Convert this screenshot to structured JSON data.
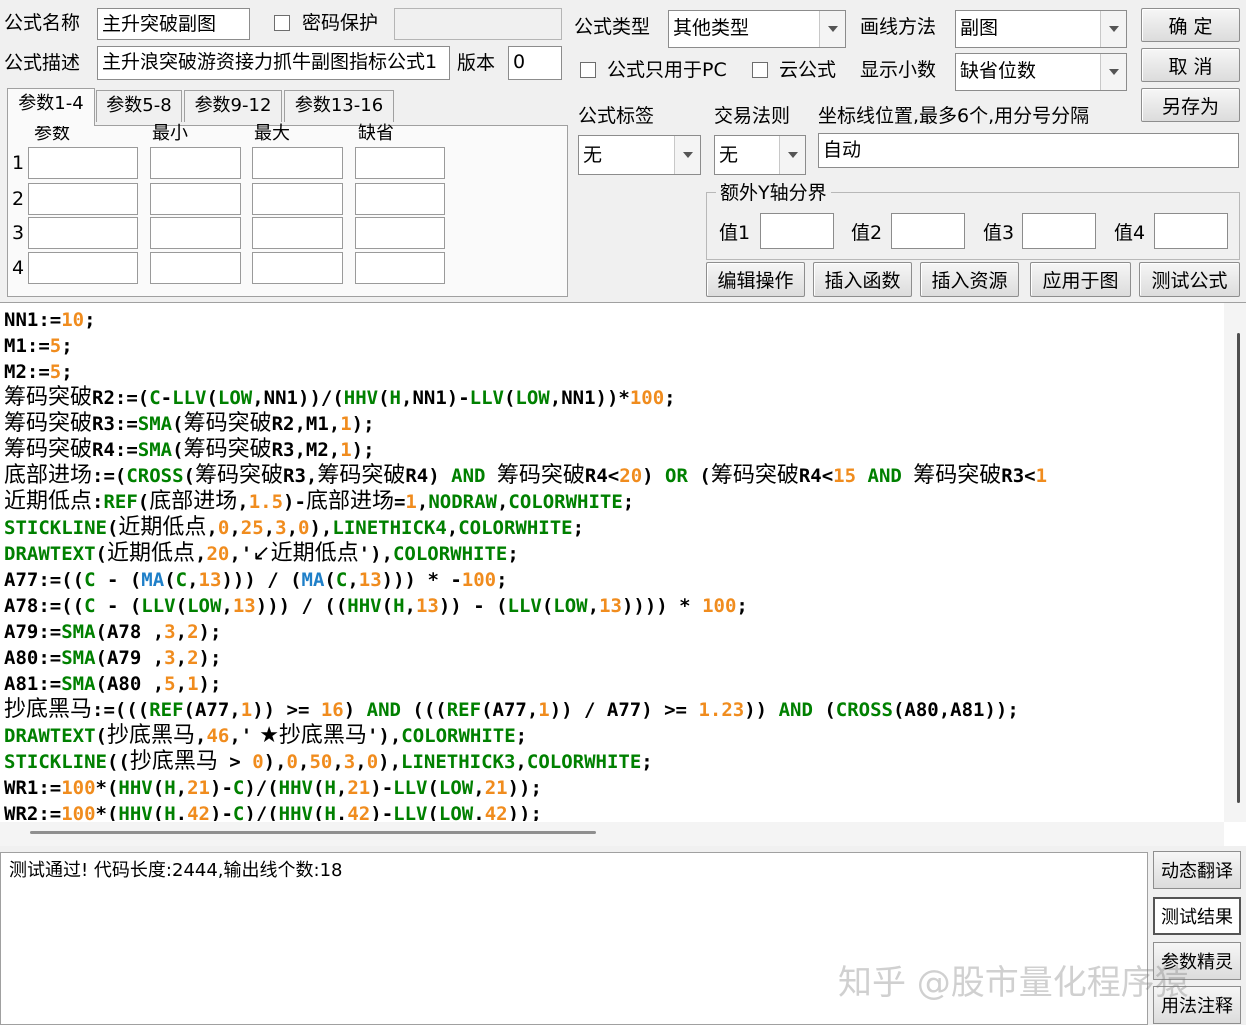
{
  "form": {
    "name_label": "公式名称",
    "name_value": "主升突破副图",
    "password_label": "密码保护",
    "desc_label": "公式描述",
    "desc_value": "主升浪突破游资接力抓牛副图指标公式1",
    "version_label": "版本",
    "version_value": "0",
    "type_label": "公式类型",
    "type_value": "其他类型",
    "draw_label": "画线方法",
    "draw_value": "副图",
    "pc_only_label": "公式只用于PC",
    "cloud_label": "云公式",
    "decimals_label": "显示小数",
    "decimals_value": "缺省位数",
    "tag_label": "公式标签",
    "tag_value": "无",
    "rule_label": "交易法则",
    "rule_value": "无",
    "axis_label": "坐标线位置,最多6个,用分号分隔",
    "axis_value": "自动",
    "extra_y_label": "额外Y轴分界",
    "extra_y": [
      "值1",
      "值2",
      "值3",
      "值4"
    ]
  },
  "buttons": {
    "ok": "确  定",
    "cancel": "取  消",
    "save_as": "另存为",
    "edit_ops": "编辑操作",
    "insert_func": "插入函数",
    "insert_res": "插入资源",
    "apply_chart": "应用于图",
    "test_formula": "测试公式"
  },
  "params": {
    "tabs": [
      "参数1-4",
      "参数5-8",
      "参数9-12",
      "参数13-16"
    ],
    "headers": [
      "参数",
      "最小",
      "最大",
      "缺省"
    ],
    "rows": [
      "1",
      "2",
      "3",
      "4"
    ]
  },
  "code_lines": [
    [
      [
        "t",
        "NN1:="
      ],
      [
        "n",
        "10"
      ],
      [
        "t",
        ";"
      ]
    ],
    [
      [
        "t",
        "M1:="
      ],
      [
        "n",
        "5"
      ],
      [
        "t",
        ";"
      ]
    ],
    [
      [
        "t",
        "M2:="
      ],
      [
        "n",
        "5"
      ],
      [
        "t",
        ";"
      ]
    ],
    [
      [
        "cj",
        "筹码突破"
      ],
      [
        "t",
        "R2:=("
      ],
      [
        "k",
        "C"
      ],
      [
        "t",
        "-"
      ],
      [
        "k",
        "LLV"
      ],
      [
        "t",
        "("
      ],
      [
        "k",
        "LOW"
      ],
      [
        "t",
        ",NN1)"
      ],
      [
        "t",
        ")/("
      ],
      [
        "k",
        "HHV"
      ],
      [
        "t",
        "("
      ],
      [
        "k",
        "H"
      ],
      [
        "t",
        ",NN1)-"
      ],
      [
        "k",
        "LLV"
      ],
      [
        "t",
        "("
      ],
      [
        "k",
        "LOW"
      ],
      [
        "t",
        ",NN1))*"
      ],
      [
        "n",
        "100"
      ],
      [
        "t",
        ";"
      ]
    ],
    [
      [
        "cj",
        "筹码突破"
      ],
      [
        "t",
        "R3:="
      ],
      [
        "k",
        "SMA"
      ],
      [
        "t",
        "("
      ],
      [
        "cj",
        "筹码突破"
      ],
      [
        "t",
        "R2,M1,"
      ],
      [
        "n",
        "1"
      ],
      [
        "t",
        ");"
      ]
    ],
    [
      [
        "cj",
        "筹码突破"
      ],
      [
        "t",
        "R4:="
      ],
      [
        "k",
        "SMA"
      ],
      [
        "t",
        "("
      ],
      [
        "cj",
        "筹码突破"
      ],
      [
        "t",
        "R3,M2,"
      ],
      [
        "n",
        "1"
      ],
      [
        "t",
        ");"
      ]
    ],
    [
      [
        "cj",
        "底部进场"
      ],
      [
        "t",
        ":=("
      ],
      [
        "k",
        "CROSS"
      ],
      [
        "t",
        "("
      ],
      [
        "cj",
        "筹码突破"
      ],
      [
        "t",
        "R3,"
      ],
      [
        "cj",
        "筹码突破"
      ],
      [
        "t",
        "R4) "
      ],
      [
        "k",
        "AND"
      ],
      [
        "t",
        " "
      ],
      [
        "cj",
        "筹码突破"
      ],
      [
        "t",
        "R4<"
      ],
      [
        "n",
        "20"
      ],
      [
        "t",
        ") "
      ],
      [
        "k",
        "OR"
      ],
      [
        "t",
        " ("
      ],
      [
        "cj",
        "筹码突破"
      ],
      [
        "t",
        "R4<"
      ],
      [
        "n",
        "15"
      ],
      [
        "t",
        " "
      ],
      [
        "k",
        "AND"
      ],
      [
        "t",
        " "
      ],
      [
        "cj",
        "筹码突破"
      ],
      [
        "t",
        "R3<"
      ],
      [
        "n",
        "1"
      ]
    ],
    [
      [
        "cj",
        "近期低点"
      ],
      [
        "t",
        ":"
      ],
      [
        "k",
        "REF"
      ],
      [
        "t",
        "("
      ],
      [
        "cj",
        "底部进场"
      ],
      [
        "t",
        ","
      ],
      [
        "n",
        "1.5"
      ],
      [
        "t",
        ")-"
      ],
      [
        "cj",
        "底部进场"
      ],
      [
        "t",
        "="
      ],
      [
        "n",
        "1"
      ],
      [
        "t",
        ","
      ],
      [
        "k",
        "NODRAW"
      ],
      [
        "t",
        ","
      ],
      [
        "k",
        "COLORWHITE"
      ],
      [
        "t",
        ";"
      ]
    ],
    [
      [
        "k",
        "STICKLINE"
      ],
      [
        "t",
        "("
      ],
      [
        "cj",
        "近期低点"
      ],
      [
        "t",
        ","
      ],
      [
        "n",
        "0"
      ],
      [
        "t",
        ","
      ],
      [
        "n",
        "25"
      ],
      [
        "t",
        ","
      ],
      [
        "n",
        "3"
      ],
      [
        "t",
        ","
      ],
      [
        "n",
        "0"
      ],
      [
        "t",
        "),"
      ],
      [
        "k",
        "LINETHICK4"
      ],
      [
        "t",
        ","
      ],
      [
        "k",
        "COLORWHITE"
      ],
      [
        "t",
        ";"
      ]
    ],
    [
      [
        "k",
        "DRAWTEXT"
      ],
      [
        "t",
        "("
      ],
      [
        "cj",
        "近期低点"
      ],
      [
        "t",
        ","
      ],
      [
        "n",
        "20"
      ],
      [
        "t",
        ",'"
      ],
      [
        "cj",
        "↙近期低点"
      ],
      [
        "t",
        "'),"
      ],
      [
        "k",
        "COLORWHITE"
      ],
      [
        "t",
        ";"
      ]
    ],
    [
      [
        "t",
        "A77:=(("
      ],
      [
        "k",
        "C"
      ],
      [
        "t",
        " - ("
      ],
      [
        "b",
        "MA"
      ],
      [
        "t",
        "("
      ],
      [
        "k",
        "C"
      ],
      [
        "t",
        ","
      ],
      [
        "n",
        "13"
      ],
      [
        "t",
        ")))"
      ],
      [
        "t",
        " / ("
      ],
      [
        "b",
        "MA"
      ],
      [
        "t",
        "("
      ],
      [
        "k",
        "C"
      ],
      [
        "t",
        ","
      ],
      [
        "n",
        "13"
      ],
      [
        "t",
        ")))"
      ],
      [
        "t",
        " * -"
      ],
      [
        "n",
        "100"
      ],
      [
        "t",
        ";"
      ]
    ],
    [
      [
        "t",
        "A78:=(("
      ],
      [
        "k",
        "C"
      ],
      [
        "t",
        " - ("
      ],
      [
        "k",
        "LLV"
      ],
      [
        "t",
        "("
      ],
      [
        "k",
        "LOW"
      ],
      [
        "t",
        ","
      ],
      [
        "n",
        "13"
      ],
      [
        "t",
        ")))"
      ],
      [
        "t",
        " / (("
      ],
      [
        "k",
        "HHV"
      ],
      [
        "t",
        "("
      ],
      [
        "k",
        "H"
      ],
      [
        "t",
        ","
      ],
      [
        "n",
        "13"
      ],
      [
        "t",
        "))"
      ],
      [
        "t",
        " - ("
      ],
      [
        "k",
        "LLV"
      ],
      [
        "t",
        "("
      ],
      [
        "k",
        "LOW"
      ],
      [
        "t",
        ","
      ],
      [
        "n",
        "13"
      ],
      [
        "t",
        "))))"
      ],
      [
        "t",
        " * "
      ],
      [
        "n",
        "100"
      ],
      [
        "t",
        ";"
      ]
    ],
    [
      [
        "t",
        "A79:="
      ],
      [
        "k",
        "SMA"
      ],
      [
        "t",
        "(A78 ,"
      ],
      [
        "n",
        "3"
      ],
      [
        "t",
        ","
      ],
      [
        "n",
        "2"
      ],
      [
        "t",
        ");"
      ]
    ],
    [
      [
        "t",
        "A80:="
      ],
      [
        "k",
        "SMA"
      ],
      [
        "t",
        "(A79 ,"
      ],
      [
        "n",
        "3"
      ],
      [
        "t",
        ","
      ],
      [
        "n",
        "2"
      ],
      [
        "t",
        ");"
      ]
    ],
    [
      [
        "t",
        "A81:="
      ],
      [
        "k",
        "SMA"
      ],
      [
        "t",
        "(A80 ,"
      ],
      [
        "n",
        "5"
      ],
      [
        "t",
        ","
      ],
      [
        "n",
        "1"
      ],
      [
        "t",
        ");"
      ]
    ],
    [
      [
        "cj",
        "抄底黑马"
      ],
      [
        "t",
        ":=((("
      ],
      [
        "k",
        "REF"
      ],
      [
        "t",
        "(A77,"
      ],
      [
        "n",
        "1"
      ],
      [
        "t",
        "))"
      ],
      [
        "t",
        " >= "
      ],
      [
        "n",
        "16"
      ],
      [
        "t",
        ") "
      ],
      [
        "k",
        "AND"
      ],
      [
        "t",
        " ((("
      ],
      [
        "k",
        "REF"
      ],
      [
        "t",
        "(A77,"
      ],
      [
        "n",
        "1"
      ],
      [
        "t",
        "))"
      ],
      [
        "t",
        " / A77) >= "
      ],
      [
        "n",
        "1.23"
      ],
      [
        "t",
        "))"
      ],
      [
        "t",
        " "
      ],
      [
        "k",
        "AND"
      ],
      [
        "t",
        " ("
      ],
      [
        "k",
        "CROSS"
      ],
      [
        "t",
        "(A80,A81));"
      ]
    ],
    [
      [
        "k",
        "DRAWTEXT"
      ],
      [
        "t",
        "("
      ],
      [
        "cj",
        "抄底黑马"
      ],
      [
        "t",
        ","
      ],
      [
        "n",
        "46"
      ],
      [
        "t",
        ",'"
      ],
      [
        "cj",
        " ★抄底黑马"
      ],
      [
        "t",
        "'),"
      ],
      [
        "k",
        "COLORWHITE"
      ],
      [
        "t",
        ";"
      ]
    ],
    [
      [
        "k",
        "STICKLINE"
      ],
      [
        "t",
        "(("
      ],
      [
        "cj",
        "抄底黑马"
      ],
      [
        "t",
        " > "
      ],
      [
        "n",
        "0"
      ],
      [
        "t",
        "),"
      ],
      [
        "n",
        "0"
      ],
      [
        "t",
        ","
      ],
      [
        "n",
        "50"
      ],
      [
        "t",
        ","
      ],
      [
        "n",
        "3"
      ],
      [
        "t",
        ","
      ],
      [
        "n",
        "0"
      ],
      [
        "t",
        "),"
      ],
      [
        "k",
        "LINETHICK3"
      ],
      [
        "t",
        ","
      ],
      [
        "k",
        "COLORWHITE"
      ],
      [
        "t",
        ";"
      ]
    ],
    [
      [
        "t",
        "WR1:="
      ],
      [
        "n",
        "100"
      ],
      [
        "t",
        "*("
      ],
      [
        "k",
        "HHV"
      ],
      [
        "t",
        "("
      ],
      [
        "k",
        "H"
      ],
      [
        "t",
        ","
      ],
      [
        "n",
        "21"
      ],
      [
        "t",
        ")-"
      ],
      [
        "k",
        "C"
      ],
      [
        "t",
        ")/("
      ],
      [
        "k",
        "HHV"
      ],
      [
        "t",
        "("
      ],
      [
        "k",
        "H"
      ],
      [
        "t",
        ","
      ],
      [
        "n",
        "21"
      ],
      [
        "t",
        ")-"
      ],
      [
        "k",
        "LLV"
      ],
      [
        "t",
        "("
      ],
      [
        "k",
        "LOW"
      ],
      [
        "t",
        ","
      ],
      [
        "n",
        "21"
      ],
      [
        "t",
        "));"
      ]
    ],
    [
      [
        "t",
        "WR2:="
      ],
      [
        "n",
        "100"
      ],
      [
        "t",
        "*("
      ],
      [
        "k",
        "HHV"
      ],
      [
        "t",
        "("
      ],
      [
        "k",
        "H"
      ],
      [
        "t",
        "."
      ],
      [
        "n",
        "42"
      ],
      [
        "t",
        ")-"
      ],
      [
        "k",
        "C"
      ],
      [
        "t",
        ")/("
      ],
      [
        "k",
        "HHV"
      ],
      [
        "t",
        "("
      ],
      [
        "k",
        "H"
      ],
      [
        "t",
        "."
      ],
      [
        "n",
        "42"
      ],
      [
        "t",
        ")-"
      ],
      [
        "k",
        "LLV"
      ],
      [
        "t",
        "("
      ],
      [
        "k",
        "LOW"
      ],
      [
        "t",
        "."
      ],
      [
        "n",
        "42"
      ],
      [
        "t",
        "));"
      ]
    ]
  ],
  "output": {
    "message": "测试通过! 代码长度:2444,输出线个数:18"
  },
  "side_buttons": [
    "动态翻译",
    "测试结果",
    "参数精灵",
    "用法注释"
  ],
  "watermark": "知乎 @股市量化程序猿",
  "colors": {
    "keyword": "#008000",
    "number": "#f08c1e",
    "builtin_ma": "#1e7fc8",
    "text": "#000000"
  }
}
